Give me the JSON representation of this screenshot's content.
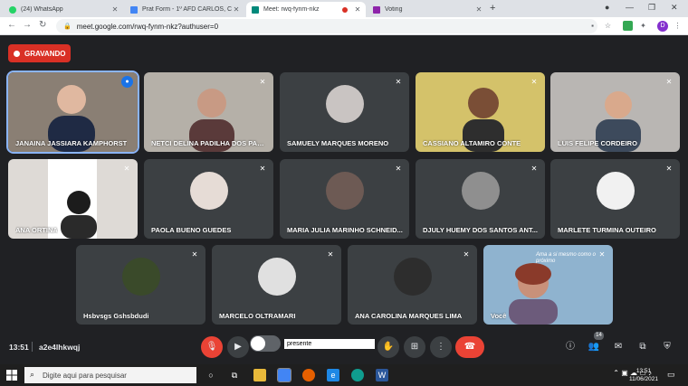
{
  "browser": {
    "tabs": [
      {
        "title": "(24) WhatsApp",
        "color": "#25d366"
      },
      {
        "title": "Prat Form - 1º AFD CARLOS, C E",
        "color": "#4285f4"
      },
      {
        "title": "Meet: rwq-fynm-nkz",
        "color": "#00897b"
      },
      {
        "title": "Voting",
        "color": "#8e24aa"
      }
    ],
    "new_tab": "+",
    "url": "meet.google.com/rwq-fynm-nkz?authuser=0",
    "profile_initial": "D"
  },
  "meet": {
    "recording_label": "GRAVANDO",
    "row1": [
      {
        "name": "JANAINA JASSIARA KAMPHORST",
        "kind": "video",
        "bg": "#8a7f74",
        "speaking": true
      },
      {
        "name": "NETCI DELINA PADILHA DOS PAS...",
        "kind": "video",
        "bg": "#b5b0a8"
      },
      {
        "name": "SAMUELY MARQUES MORENO",
        "kind": "avatar",
        "bg": "#c9c4c2"
      },
      {
        "name": "CASSIANO ALTAMIRO CONTE",
        "kind": "video",
        "bg": "#d4c26a"
      },
      {
        "name": "LUIS FELIPE CORDEIRO",
        "kind": "video",
        "bg": "#b9b6b3"
      }
    ],
    "row2": [
      {
        "name": "ANA ORTINA",
        "kind": "video",
        "bg": "#dedad6"
      },
      {
        "name": "PAOLA BUENO GUEDES",
        "kind": "avatar",
        "bg": "#e6dcd6"
      },
      {
        "name": "MARIA JULIA MARINHO SCHNEID...",
        "kind": "avatar",
        "bg": "#6d5a54"
      },
      {
        "name": "DJULY HUEMY DOS SANTOS ANT...",
        "kind": "avatar",
        "bg": "#8f8f8f"
      },
      {
        "name": "MARLETE TURMINA OUTEIRO",
        "kind": "avatar",
        "bg": "#f1f1f1"
      }
    ],
    "row3": [
      {
        "name": "Hsbvsgs Gshsbdudi",
        "kind": "avatar",
        "bg": "#3a4a2a"
      },
      {
        "name": "MARCELO OLTRAMARI",
        "kind": "avatar",
        "bg": "#e0e0e0"
      },
      {
        "name": "ANA CAROLINA MARQUES LIMA",
        "kind": "avatar",
        "bg": "#2d2d2d"
      },
      {
        "name": "Você",
        "kind": "video",
        "bg": "#8fb3cf"
      }
    ],
    "self_overlay_text": "Ama a si mesmo como o próximo",
    "time": "13:51",
    "meeting_code": "a2e4lhkwqj",
    "attendance_value": "presente",
    "people_count": "14"
  },
  "taskbar": {
    "search_placeholder": "Digite aqui para pesquisar",
    "time": "13:51",
    "date": "11/06/2021"
  }
}
